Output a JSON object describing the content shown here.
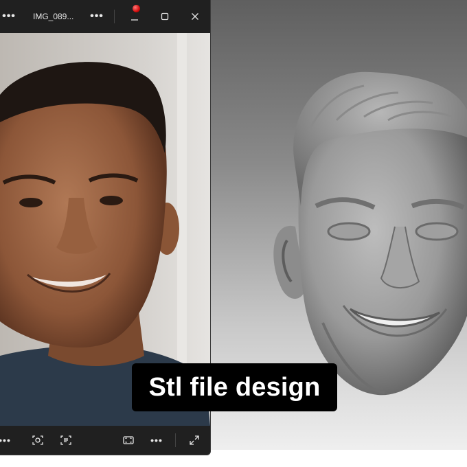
{
  "viewer": {
    "title": "IMG_089...",
    "more_label": "•••",
    "bottom_more_label": "•••"
  },
  "caption": {
    "text": "Stl file design"
  },
  "icons": {
    "more": "ellipsis-icon",
    "minimize": "minimize-icon",
    "maximize": "maximize-icon",
    "close": "close-icon",
    "recording": "recording-dot-icon",
    "visual_search": "visual-search-icon",
    "text_scan": "text-scan-icon",
    "fit": "fit-to-window-icon",
    "fullscreen": "expand-icon"
  },
  "colors": {
    "titlebar": "#202020",
    "caption_bg": "#000000",
    "caption_text": "#ffffff",
    "rec_dot": "#d40d0d"
  }
}
